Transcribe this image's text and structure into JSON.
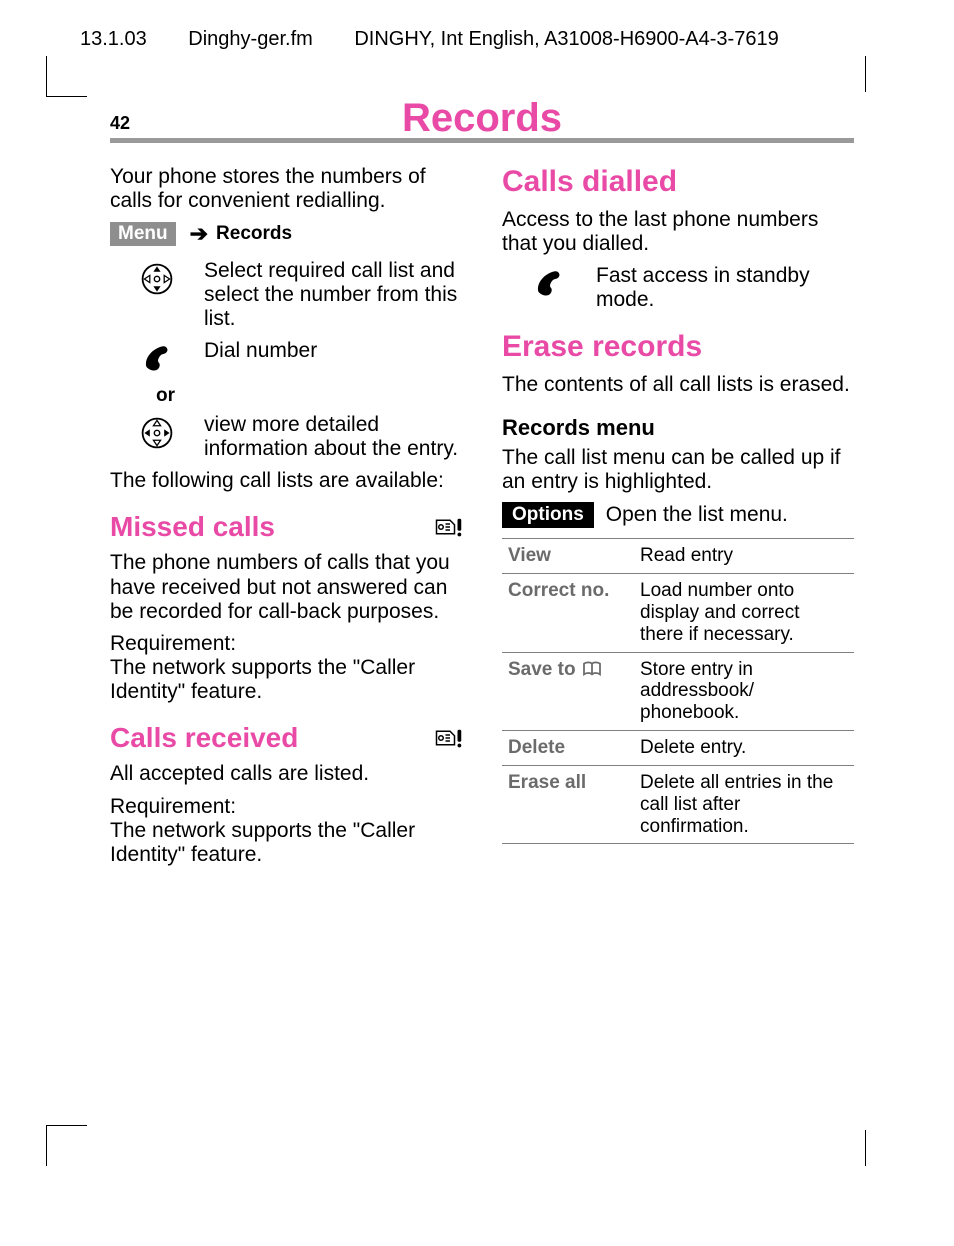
{
  "header": {
    "date": "13.1.03",
    "file": "Dinghy-ger.fm",
    "doc_id": "DINGHY, Int English, A31008-H6900-A4-3-7619"
  },
  "page_number": "42",
  "title": "Records",
  "left": {
    "intro": "Your phone stores the numbers  of calls for convenient redialling.",
    "menu_label": "Menu",
    "menu_target": "Records",
    "step_select": "Select required call list and select the number from this list.",
    "step_dial": "Dial number",
    "or": "or",
    "step_detail": "view more detailed information about the entry.",
    "lists_intro": "The following call lists are available:",
    "missed_h": "Missed calls",
    "missed_p": "The phone numbers of calls that you have received but not answered can be recorded for call-back purposes.",
    "req_label_1": "Requirement:",
    "req_text_1": "The network supports the  \"Caller Identity\" feature.",
    "received_h": "Calls received",
    "received_p": "All accepted calls are listed.",
    "req_label_2": "Requirement:",
    "req_text_2": "The network supports the \"Caller Identity\" feature."
  },
  "right": {
    "dialled_h": "Calls dialled",
    "dialled_p": "Access to the last phone numbers that you dialled.",
    "dialled_step": "Fast access in standby mode.",
    "erase_h": "Erase records",
    "erase_p": "The contents of all call lists is erased.",
    "records_menu_h": "Records menu",
    "records_menu_p": "The call list menu can be called up if an entry is highlighted.",
    "options_label": "Options",
    "options_text": "Open the list menu.",
    "table": [
      {
        "k": "View",
        "v": "Read entry"
      },
      {
        "k": "Correct no.",
        "v": "Load number onto display and correct there if necessary."
      },
      {
        "k": "Save to",
        "icon": "book",
        "v": "Store entry in addressbook/ phonebook."
      },
      {
        "k": "Delete",
        "v": "Delete entry."
      },
      {
        "k": "Erase all",
        "v": "Delete all entries in the call list after confirmation."
      }
    ]
  }
}
